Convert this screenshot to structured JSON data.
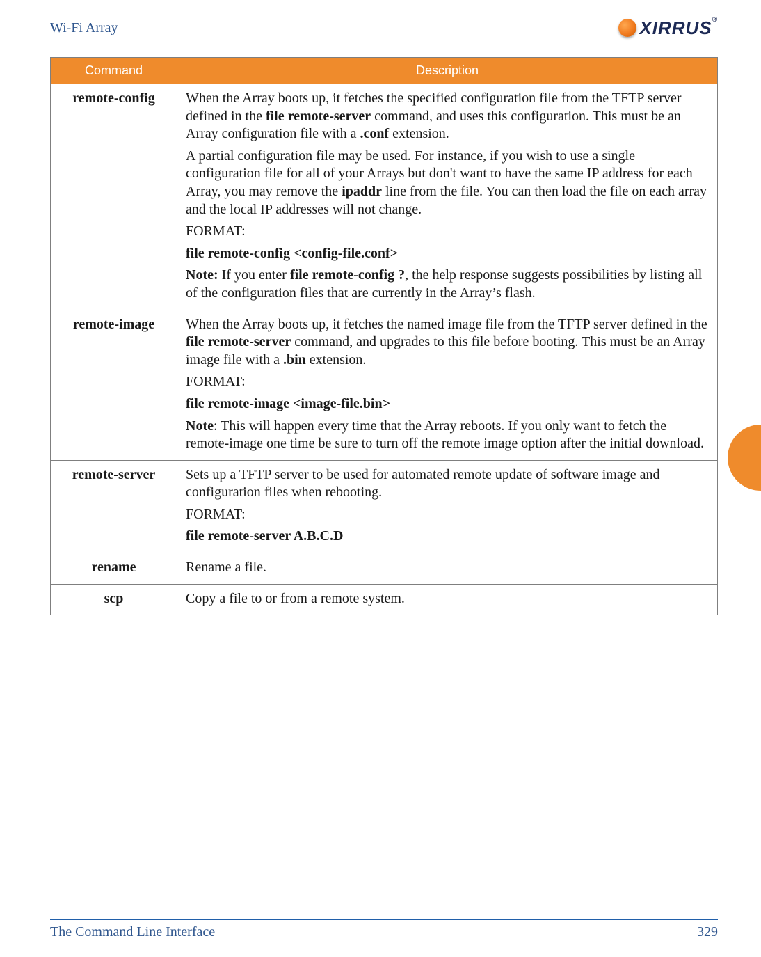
{
  "header": {
    "doc_title": "Wi-Fi Array",
    "brand_word": "XIRRUS",
    "brand_reg": "®"
  },
  "table": {
    "head": {
      "c1": "Command",
      "c2": "Description"
    },
    "rows": [
      {
        "cmd": "remote-config",
        "desc": {
          "p1a": "When the Array boots up, it fetches the specified configuration file from the TFTP server defined in the ",
          "p1b": "file remote-server",
          "p1c": " command, and uses this configuration. This must be an Array configuration file with a ",
          "p1d": ".conf",
          "p1e": " extension.",
          "p2a": "A partial configuration file may be used. For instance, if you wish to use a single configuration file for all of your Arrays but don't want to have the same IP address for each Array, you may remove the ",
          "p2b": "ipaddr",
          "p2c": " line from the file. You can then load the file on each array and the local IP addresses will not change.",
          "p3": "FORMAT:",
          "p4": "file remote-config <config-file.conf>",
          "p5a": "Note:",
          "p5b": " If you enter ",
          "p5c": "file remote-config ?",
          "p5d": ", the help response suggests possibilities by listing all of the configuration files that are currently in the Array’s flash."
        }
      },
      {
        "cmd": "remote-image",
        "desc": {
          "p1a": "When the Array boots up, it fetches the named image file from the TFTP server defined in the ",
          "p1b": "file remote-server",
          "p1c": " command, and upgrades to this file before booting. This must be an Array image file with a ",
          "p1d": ".bin",
          "p1e": " extension.",
          "p2": "FORMAT:",
          "p3": "file remote-image <image-file.bin>",
          "p4a": "Note",
          "p4b": ": This will happen every time that the Array reboots. If you only want to fetch the remote-image one time be sure to turn off the remote image option after the initial download."
        }
      },
      {
        "cmd": "remote-server",
        "desc": {
          "p1": "Sets up a TFTP server to be used for automated remote update of software image and configuration files when rebooting.",
          "p2": "FORMAT:",
          "p3": "file remote-server A.B.C.D"
        }
      },
      {
        "cmd": "rename",
        "desc": {
          "p1": "Rename a file."
        }
      },
      {
        "cmd": "scp",
        "desc": {
          "p1": "Copy a file to or from a remote system."
        }
      }
    ]
  },
  "footer": {
    "section": "The Command Line Interface",
    "page": "329"
  }
}
